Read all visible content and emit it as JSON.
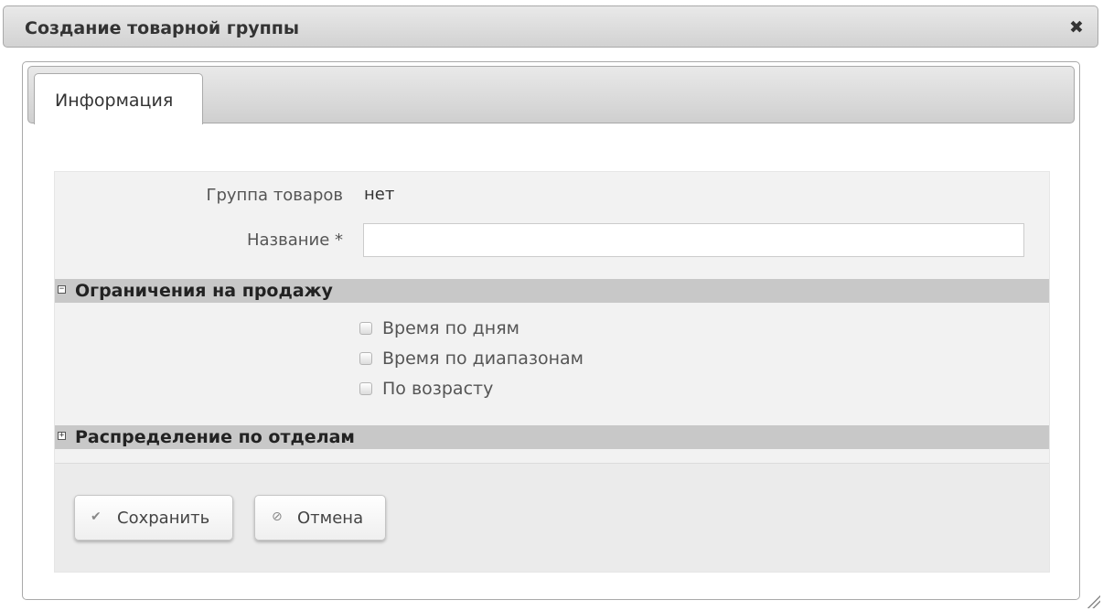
{
  "dialog": {
    "title": "Создание товарной группы",
    "close_glyph": "✖"
  },
  "tabs": [
    {
      "label": "Информация",
      "active": true
    }
  ],
  "form": {
    "group_label": "Группа товаров",
    "group_value": "нет",
    "name_label": "Название *",
    "name_value": "",
    "name_placeholder": ""
  },
  "sections": {
    "restrictions": {
      "title": "Ограничения на продажу",
      "toggle": "−",
      "expanded": true,
      "options": [
        {
          "label": "Время по дням",
          "checked": false
        },
        {
          "label": "Время по диапазонам",
          "checked": false
        },
        {
          "label": "По возрасту",
          "checked": false
        }
      ]
    },
    "departments": {
      "title": "Распределение по отделам",
      "toggle": "+",
      "expanded": false
    }
  },
  "buttons": {
    "save_label": "Сохранить",
    "save_icon": "✔",
    "cancel_label": "Отмена",
    "cancel_icon": "⊘"
  },
  "icons": {
    "close": "close-icon",
    "save": "checkmark-icon",
    "cancel": "cancel-icon",
    "collapse": "minus-box-icon",
    "expand": "plus-box-icon",
    "resize": "resize-grip-icon"
  }
}
